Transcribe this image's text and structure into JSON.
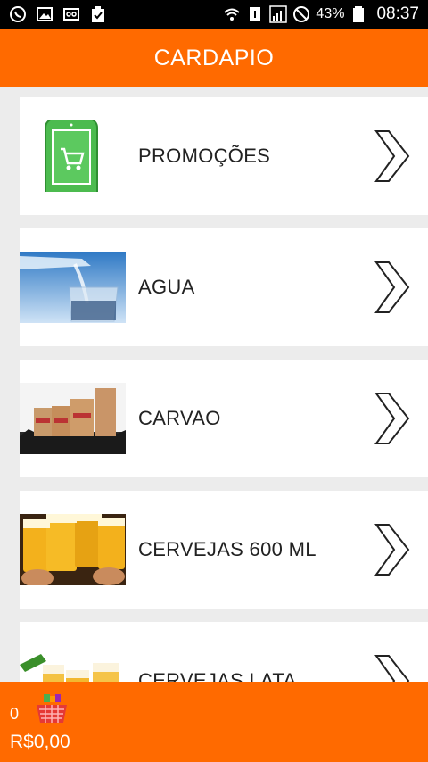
{
  "status_bar": {
    "battery": "43%",
    "time": "08:37",
    "icons_left": [
      "whatsapp-icon",
      "gallery-icon",
      "voicemail-icon",
      "clipboard-icon"
    ],
    "icons_right": [
      "wifi-icon",
      "sim-icon",
      "signal-icon",
      "no-disturb-icon",
      "battery-icon"
    ]
  },
  "appbar": {
    "title": "CARDAPIO"
  },
  "menu": {
    "items": [
      {
        "label": "PROMOÇÕES",
        "image": "phone-cart-icon"
      },
      {
        "label": "AGUA",
        "image": "water-glass-image"
      },
      {
        "label": "CARVAO",
        "image": "charcoal-bags-image"
      },
      {
        "label": "CERVEJAS 600 ML",
        "image": "beer-toast-image"
      },
      {
        "label": "CERVEJAS LATA",
        "image": "beer-glasses-image"
      }
    ]
  },
  "cart": {
    "count": "0",
    "total": "R$0,00"
  },
  "colors": {
    "accent": "#ff6a00",
    "status_bar": "#000000",
    "list_bg": "#ececec"
  }
}
